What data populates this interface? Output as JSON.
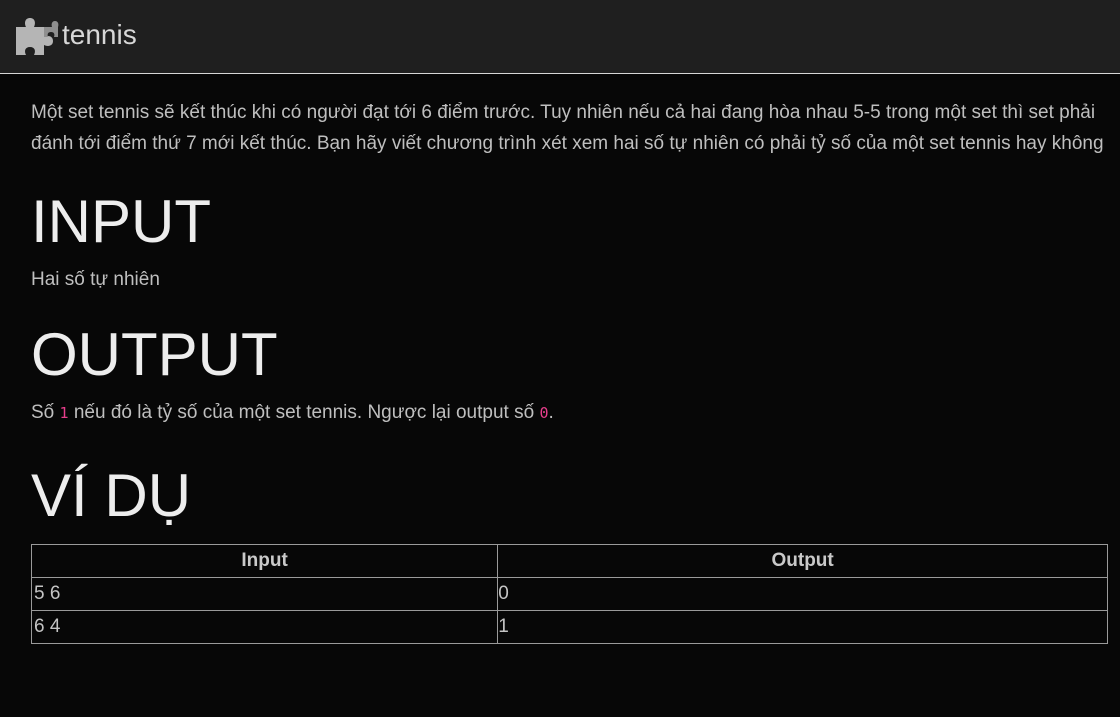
{
  "header": {
    "brand": "tennis",
    "logo_icon": "puzzle-piece-icon",
    "background": "#1f1f1f"
  },
  "problem": {
    "description": "Một set tennis sẽ kết thúc khi có người đạt tới 6 điểm trước. Tuy nhiên nếu cả hai đang hòa nhau 5-5 trong một set thì set phải đánh tới điểm thứ 7 mới kết thúc. Bạn hãy viết chương trình xét xem hai số tự nhiên có phải tỷ số của một set tennis hay không",
    "input_heading": "INPUT",
    "input_text": "Hai số tự nhiên",
    "output_heading": "OUTPUT",
    "output_text": {
      "prefix": "Số ",
      "code_true": "1",
      "middle": " nếu đó là tỷ số của một set tennis. Ngược lại output số ",
      "code_false": "0",
      "suffix": "."
    },
    "example_heading": "VÍ DỤ",
    "code_color": "#e83e8c"
  },
  "examples": {
    "headers": [
      "Input",
      "Output"
    ],
    "rows": [
      {
        "input": "5 6",
        "output": "0"
      },
      {
        "input": "6 4",
        "output": "1"
      }
    ]
  }
}
